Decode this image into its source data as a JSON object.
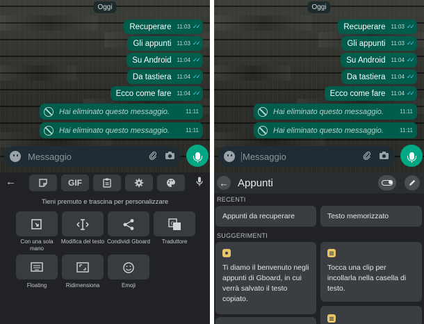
{
  "chat": {
    "date_chip": "Oggi",
    "messages": [
      {
        "text": "Recuperare",
        "time": "11:03"
      },
      {
        "text": "Gli appunti",
        "time": "11:03"
      },
      {
        "text": "Su Android",
        "time": "11:04"
      },
      {
        "text": "Da tastiera",
        "time": "11:04"
      },
      {
        "text": "Ecco come fare",
        "time": "11:04"
      }
    ],
    "deleted": [
      {
        "text": "Hai eliminato questo messaggio.",
        "time": "11:11"
      },
      {
        "text": "Hai eliminato questo messaggio.",
        "time": "11:11"
      }
    ],
    "input_placeholder": "Messaggio",
    "tick_glyph": "✓✓"
  },
  "keyboard": {
    "gif_label": "GIF",
    "hint": "Tieni premuto e trascina per personalizzare",
    "tiles": [
      {
        "label": "Con una sola mano",
        "icon": "one-hand-icon"
      },
      {
        "label": "Modifica del testo",
        "icon": "text-edit-icon"
      },
      {
        "label": "Condividi Gboard",
        "icon": "share-icon"
      },
      {
        "label": "Traduttore",
        "icon": "translate-icon"
      },
      {
        "label": "Floating",
        "icon": "floating-keyboard-icon"
      },
      {
        "label": "Ridimensiona",
        "icon": "resize-icon"
      },
      {
        "label": "Emoji",
        "icon": "emoji-icon"
      }
    ]
  },
  "clipboard": {
    "title": "Appunti",
    "recent_label": "RECENTI",
    "recent": [
      "Appunti da recuperare",
      "Testo memorizzato"
    ],
    "suggestions_label": "SUGGERIMENTI",
    "suggestions": [
      "Ti diamo il benvenuto negli appunti di Gboard, in cui verrà salvato il testo copiato.",
      "Tocca una clip per incollarla nella casella di testo."
    ]
  },
  "colors": {
    "bubble": "#005c4b",
    "tick": "#53bdeb",
    "send": "#00a884",
    "keyboard_bg": "#202226"
  }
}
